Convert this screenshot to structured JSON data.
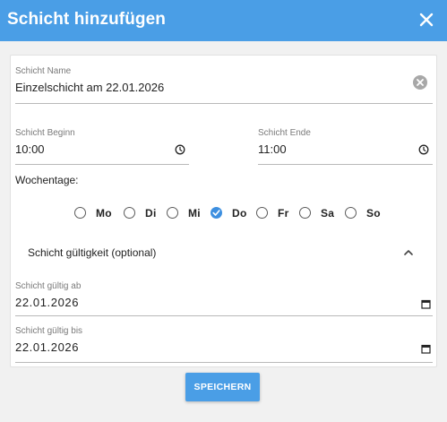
{
  "dialog": {
    "title": "Schicht hinzufügen",
    "close_icon": "close-icon"
  },
  "form": {
    "name": {
      "label": "Schicht Name",
      "value": "Einzelschicht am 22.01.2026",
      "clear_icon": "clear-circle-icon"
    },
    "start": {
      "label": "Schicht Beginn",
      "value": "10:00",
      "icon": "clock-icon"
    },
    "end": {
      "label": "Schicht Ende",
      "value": "11:00",
      "icon": "clock-icon"
    },
    "weekdays_label": "Wochentage:",
    "weekdays": [
      {
        "label": "Mo",
        "checked": false
      },
      {
        "label": "Di",
        "checked": false
      },
      {
        "label": "Mi",
        "checked": false
      },
      {
        "label": "Do",
        "checked": true
      },
      {
        "label": "Fr",
        "checked": false
      },
      {
        "label": "Sa",
        "checked": false
      },
      {
        "label": "So",
        "checked": false
      }
    ],
    "validity": {
      "title": "Schicht gültigkeit (optional)",
      "expanded": true,
      "from": {
        "label": "Schicht gültig ab",
        "value": "22.01.2026",
        "icon": "calendar-icon"
      },
      "to": {
        "label": "Schicht gültig bis",
        "value": "22.01.2026",
        "icon": "calendar-icon"
      }
    }
  },
  "actions": {
    "save_label": "SPEICHERN"
  },
  "colors": {
    "accent": "#4a9ee6",
    "checked_radio": "#3d8fe0",
    "background": "#f1f1f1"
  }
}
